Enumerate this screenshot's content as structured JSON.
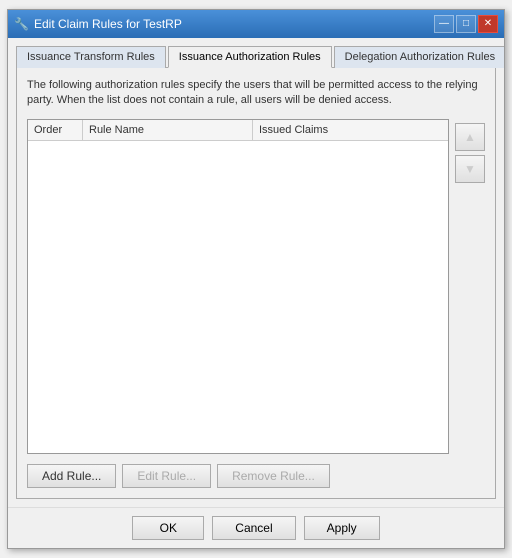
{
  "window": {
    "title": "Edit Claim Rules for TestRP",
    "icon": "🔧"
  },
  "tabs": [
    {
      "id": "issuance-transform",
      "label": "Issuance Transform Rules",
      "active": false
    },
    {
      "id": "issuance-auth",
      "label": "Issuance Authorization Rules",
      "active": true
    },
    {
      "id": "delegation-auth",
      "label": "Delegation Authorization Rules",
      "active": false
    }
  ],
  "description": "The following authorization rules specify the users that will be permitted access to the relying party. When the list does not contain a rule, all users will be denied access.",
  "table": {
    "columns": [
      {
        "id": "order",
        "label": "Order"
      },
      {
        "id": "rule-name",
        "label": "Rule Name"
      },
      {
        "id": "issued-claims",
        "label": "Issued Claims"
      }
    ],
    "rows": []
  },
  "buttons": {
    "add_rule": "Add Rule...",
    "edit_rule": "Edit Rule...",
    "remove_rule": "Remove Rule..."
  },
  "arrow_up": "▲",
  "arrow_down": "▼",
  "footer": {
    "ok": "OK",
    "cancel": "Cancel",
    "apply": "Apply"
  },
  "title_buttons": {
    "minimize": "—",
    "maximize": "□",
    "close": "✕"
  }
}
